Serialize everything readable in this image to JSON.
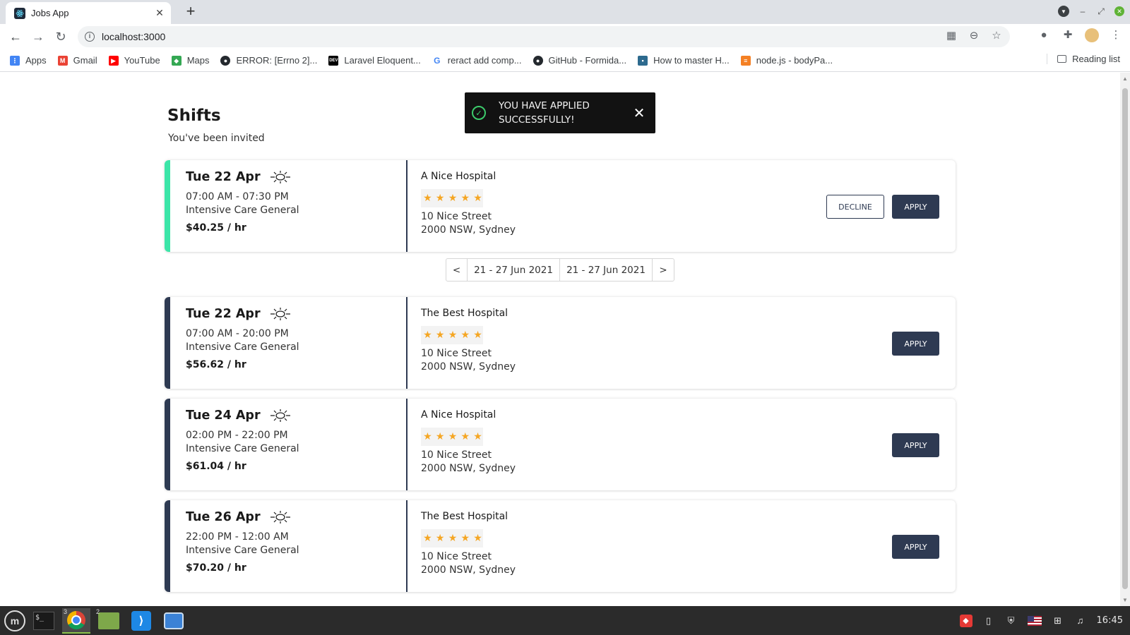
{
  "browser": {
    "tab_title": "Jobs App",
    "url": "localhost:3000",
    "bookmarks": [
      {
        "label": "Apps",
        "icon": "apps-grid-icon",
        "color": "#4285f4"
      },
      {
        "label": "Gmail",
        "icon": "gmail-icon",
        "color": "#ea4335"
      },
      {
        "label": "YouTube",
        "icon": "youtube-icon",
        "color": "#ff0000"
      },
      {
        "label": "Maps",
        "icon": "maps-icon",
        "color": "#34a853"
      },
      {
        "label": "ERROR: [Errno 2]...",
        "icon": "github-icon",
        "color": "#24292e"
      },
      {
        "label": "Laravel Eloquent...",
        "icon": "dev-icon",
        "color": "#000000"
      },
      {
        "label": "reract add comp...",
        "icon": "google-icon",
        "color": "#4285f4"
      },
      {
        "label": "GitHub - Formida...",
        "icon": "github-icon",
        "color": "#24292e"
      },
      {
        "label": "How to master H...",
        "icon": "site-icon",
        "color": "#2d6a8e"
      },
      {
        "label": "node.js - bodyPa...",
        "icon": "stackoverflow-icon",
        "color": "#f48024"
      }
    ],
    "reading_list": "Reading list"
  },
  "page": {
    "title": "Shifts",
    "subtitle": "You've been invited"
  },
  "toast": {
    "line1": "YOU HAVE APPLIED",
    "line2": "SUCCESSFULLY!",
    "status_color": "#3ccb6b"
  },
  "pager": {
    "prev": "<",
    "range_a": "21 - 27 Jun 2021",
    "range_b": "21 - 27 Jun 2021",
    "next": ">"
  },
  "shifts": [
    {
      "date": "Tue 22 Apr",
      "time": "07:00 AM - 07:30 PM",
      "ward": "Intensive Care General",
      "rate": "$40.25 / hr",
      "hospital": "A Nice Hospital",
      "rating": 5,
      "address_line1": "10 Nice Street",
      "address_line2": "2000 NSW, Sydney",
      "accent": "#3ce5a8",
      "decline_label": "DECLINE",
      "apply_label": "APPLY"
    },
    {
      "date": "Tue 22 Apr",
      "time": "07:00 AM - 20:00 PM",
      "ward": "Intensive Care General",
      "rate": "$56.62 / hr",
      "hospital": "The Best Hospital",
      "rating": 5,
      "address_line1": "10 Nice Street",
      "address_line2": "2000 NSW, Sydney",
      "accent": "#2e3a52",
      "apply_label": "APPLY"
    },
    {
      "date": "Tue 24 Apr",
      "time": "02:00 PM - 22:00 PM",
      "ward": "Intensive Care General",
      "rate": "$61.04 / hr",
      "hospital": "A Nice Hospital",
      "rating": 5,
      "address_line1": "10 Nice Street",
      "address_line2": "2000 NSW, Sydney",
      "accent": "#2e3a52",
      "apply_label": "APPLY"
    },
    {
      "date": "Tue 26 Apr",
      "time": "22:00 PM - 12:00 AM",
      "ward": "Intensive Care General",
      "rate": "$70.20 / hr",
      "hospital": "The Best Hospital",
      "rating": 5,
      "address_line1": "10 Nice Street",
      "address_line2": "2000 NSW, Sydney",
      "accent": "#2e3a52",
      "apply_label": "APPLY"
    }
  ],
  "taskbar": {
    "chrome_badge": "3",
    "files_badge": "2",
    "clock": "16:45"
  },
  "colors": {
    "primary": "#2e3a52",
    "star": "#f5a623"
  }
}
